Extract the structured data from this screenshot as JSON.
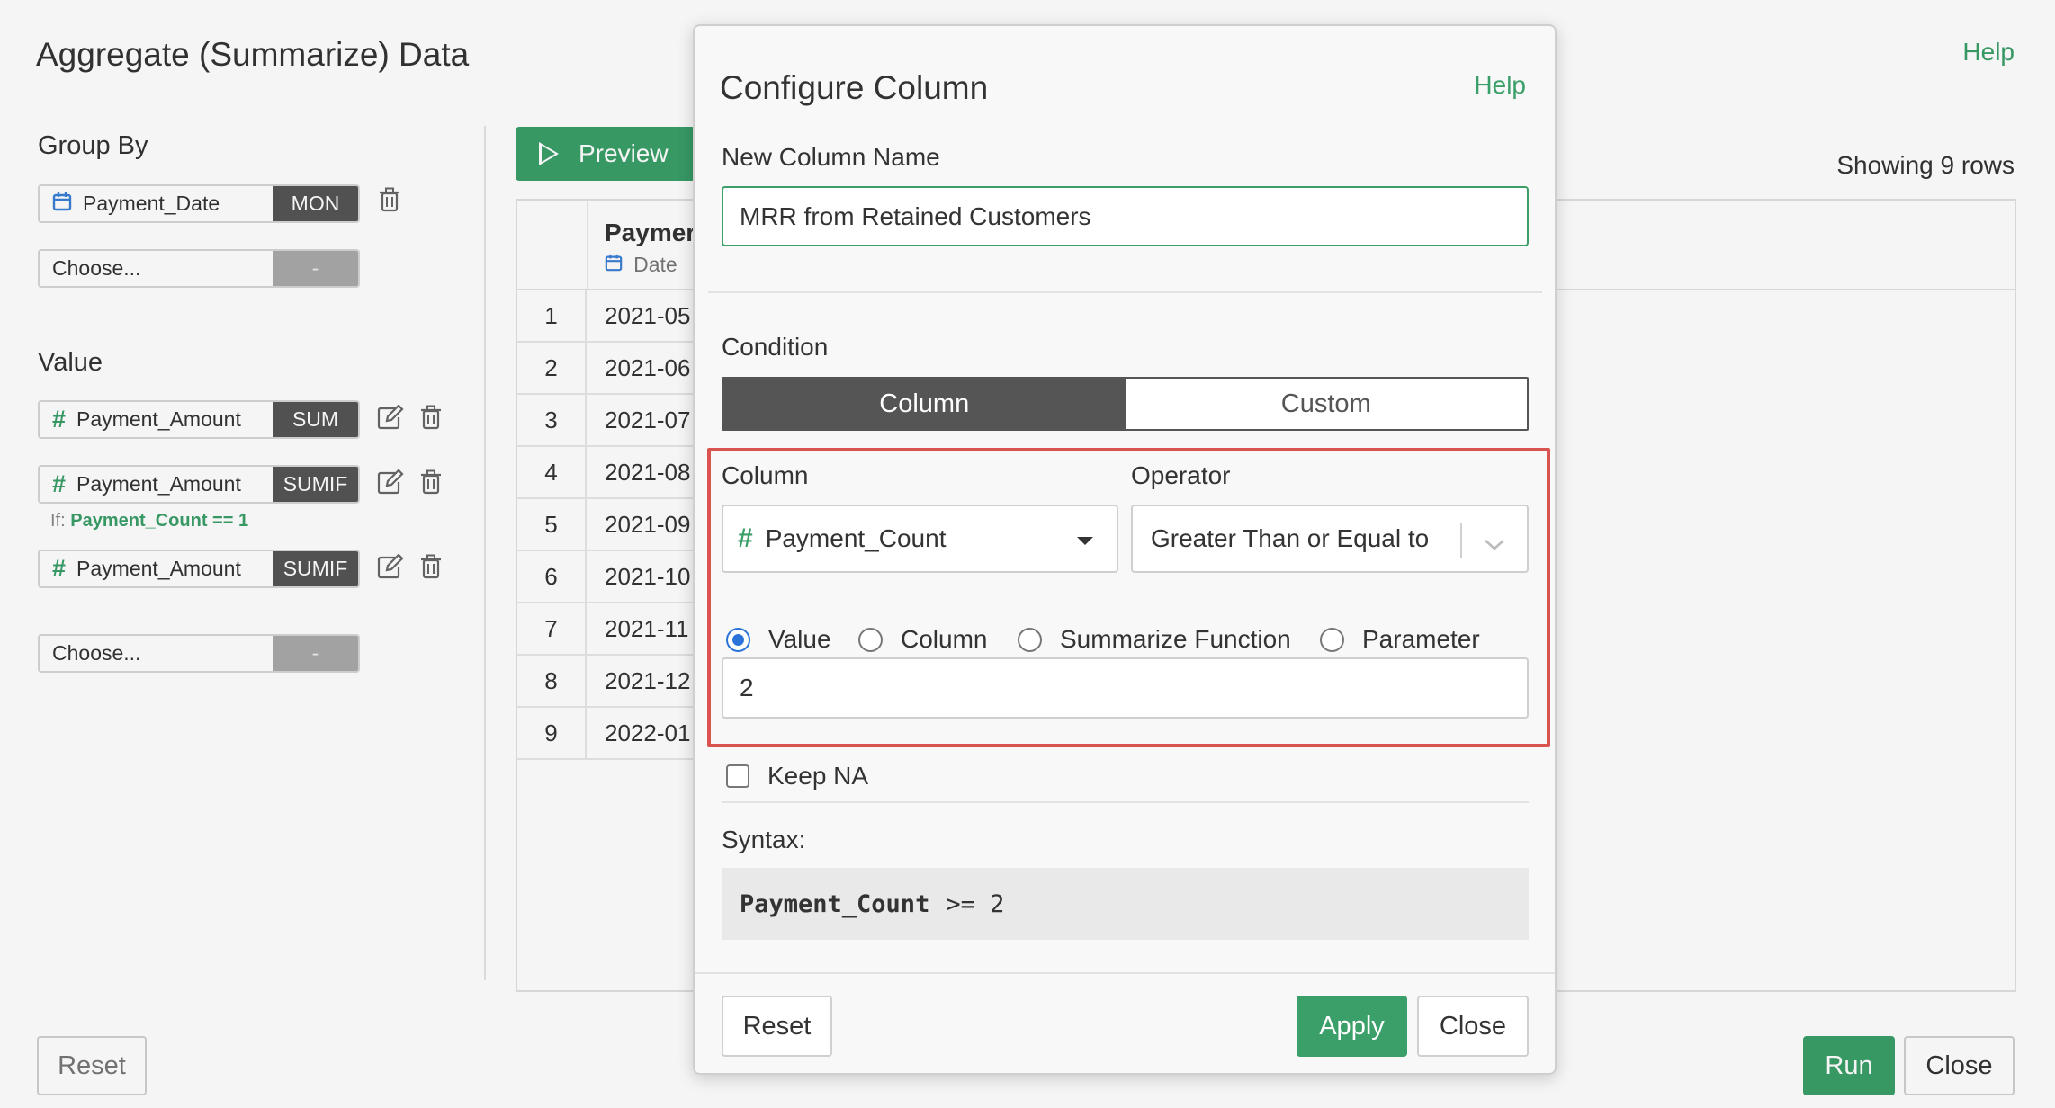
{
  "page": {
    "title": "Aggregate (Summarize) Data",
    "help": "Help",
    "group_by_label": "Group By",
    "value_label": "Value",
    "group_by": [
      {
        "column": "Payment_Date",
        "type_icon": "calendar-icon",
        "function": "MON"
      },
      {
        "column": "Choose...",
        "function": "-"
      }
    ],
    "values": [
      {
        "column": "Payment_Amount",
        "type_icon": "hash-icon",
        "function": "SUM"
      },
      {
        "column": "Payment_Amount",
        "type_icon": "hash-icon",
        "function": "SUMIF",
        "condition_prefix": "If:",
        "condition": "Payment_Count == 1"
      },
      {
        "column": "Payment_Amount",
        "type_icon": "hash-icon",
        "function": "SUMIF"
      },
      {
        "column": "Choose...",
        "function": "-"
      }
    ],
    "preview_label": "Preview",
    "showing_rows": "Showing 9 rows",
    "grid": {
      "column_name": "Paymer",
      "column_type": "Date",
      "rows": [
        {
          "num": "1",
          "value": "2021-05"
        },
        {
          "num": "2",
          "value": "2021-06"
        },
        {
          "num": "3",
          "value": "2021-07"
        },
        {
          "num": "4",
          "value": "2021-08"
        },
        {
          "num": "5",
          "value": "2021-09"
        },
        {
          "num": "6",
          "value": "2021-10"
        },
        {
          "num": "7",
          "value": "2021-11"
        },
        {
          "num": "8",
          "value": "2021-12"
        },
        {
          "num": "9",
          "value": "2022-01"
        }
      ]
    },
    "reset_label": "Reset",
    "run_label": "Run",
    "close_label": "Close"
  },
  "dialog": {
    "title": "Configure Column",
    "help": "Help",
    "new_column_name_label": "New Column Name",
    "new_column_name_value": "MRR from Retained Customers",
    "condition_label": "Condition",
    "tabs": [
      {
        "label": "Column",
        "active": true
      },
      {
        "label": "Custom",
        "active": false
      }
    ],
    "column_label": "Column",
    "column_value": "Payment_Count",
    "operator_label": "Operator",
    "operator_value": "Greater Than or Equal to",
    "value_types": [
      {
        "label": "Value",
        "checked": true
      },
      {
        "label": "Column",
        "checked": false
      },
      {
        "label": "Summarize Function",
        "checked": false
      },
      {
        "label": "Parameter",
        "checked": false
      }
    ],
    "value_input": "2",
    "keep_na_label": "Keep NA",
    "keep_na_checked": false,
    "syntax_label": "Syntax:",
    "syntax_column": "Payment_Count",
    "syntax_rest": ">= 2",
    "reset_label": "Reset",
    "apply_label": "Apply",
    "close_label": "Close"
  },
  "colors": {
    "accent_green": "#3a9f69",
    "highlight_red": "#d9534f",
    "dark_segment": "#555555",
    "radio_blue": "#2a74d9"
  }
}
